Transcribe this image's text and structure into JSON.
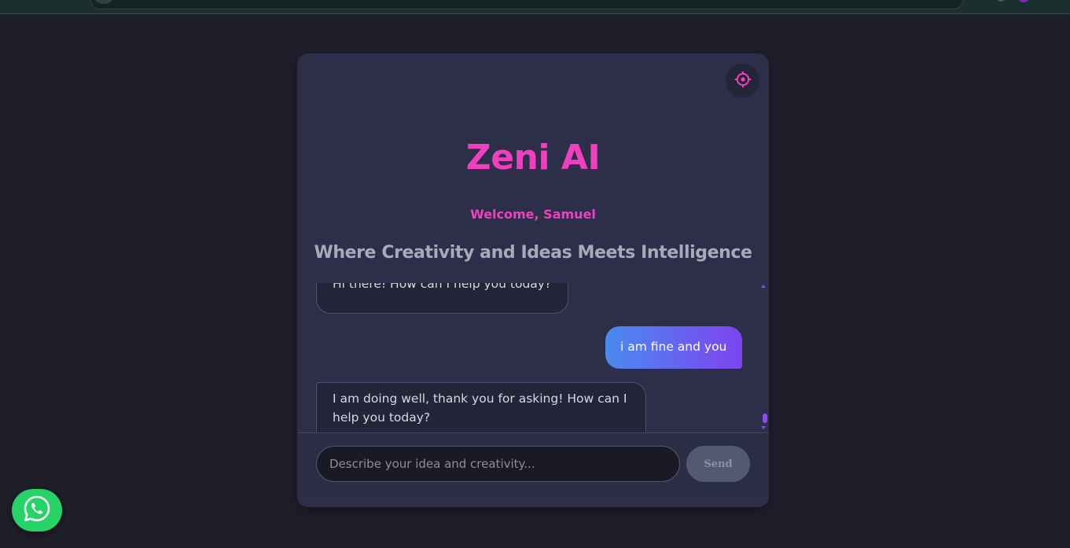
{
  "app": {
    "title": "Zeni AI",
    "welcome": "Welcome, Samuel",
    "tagline": "Where Creativity and Ideas Meets Intelligence"
  },
  "messages": [
    {
      "role": "bot",
      "text": "Hi there! How can I help you today?"
    },
    {
      "role": "user",
      "text": "i am fine and you"
    },
    {
      "role": "bot",
      "text": "I am doing well, thank you for asking! How can I help you today?"
    }
  ],
  "composer": {
    "placeholder": "Describe your idea and creativity...",
    "send_label": "Send"
  },
  "icons": {
    "settings": "gear-icon",
    "whatsapp": "whatsapp-icon"
  },
  "colors": {
    "accent": "#f040c0",
    "background": "#1f1e2b",
    "card": "#2d2f4a",
    "user_bubble_start": "#4b8aef",
    "user_bubble_end": "#7d44f0",
    "send_button": "#525a6f",
    "whatsapp": "#25d366"
  }
}
